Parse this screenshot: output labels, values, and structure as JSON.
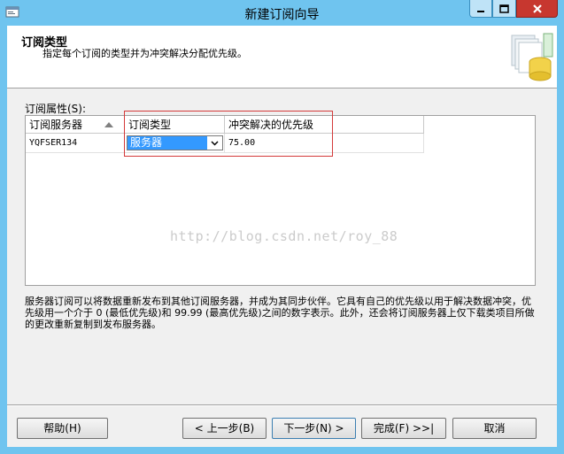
{
  "window": {
    "title": "新建订阅向导"
  },
  "header": {
    "title": "订阅类型",
    "description": "指定每个订阅的类型并为冲突解决分配优先级。",
    "graphic_icon": "database-wizard-icon"
  },
  "section": {
    "label": "订阅属性(S):"
  },
  "grid": {
    "columns": [
      "订阅服务器",
      "订阅类型",
      "冲突解决的优先级"
    ],
    "rows": [
      {
        "subscriber": "YQFSER134",
        "type": "服务器",
        "priority": "75.00"
      }
    ]
  },
  "watermark": "http://blog.csdn.net/roy_88",
  "description": "服务器订阅可以将数据重新发布到其他订阅服务器，并成为其同步伙伴。它具有自己的优先级以用于解决数据冲突，优先级用一个介于 0 (最低优先级)和 99.99 (最高优先级)之间的数字表示。此外，还会将订阅服务器上仅下载类项目所做的更改重新复制到发布服务器。",
  "buttons": {
    "help": "帮助(H)",
    "prev": "< 上一步(B)",
    "next": "下一步(N) >",
    "finish": "完成(F) >>|",
    "cancel": "取消"
  },
  "colors": {
    "titlebar": "#6fc4ef",
    "selection": "#3399ff",
    "highlight_border": "#d43a3a",
    "close_button": "#c7372f"
  }
}
